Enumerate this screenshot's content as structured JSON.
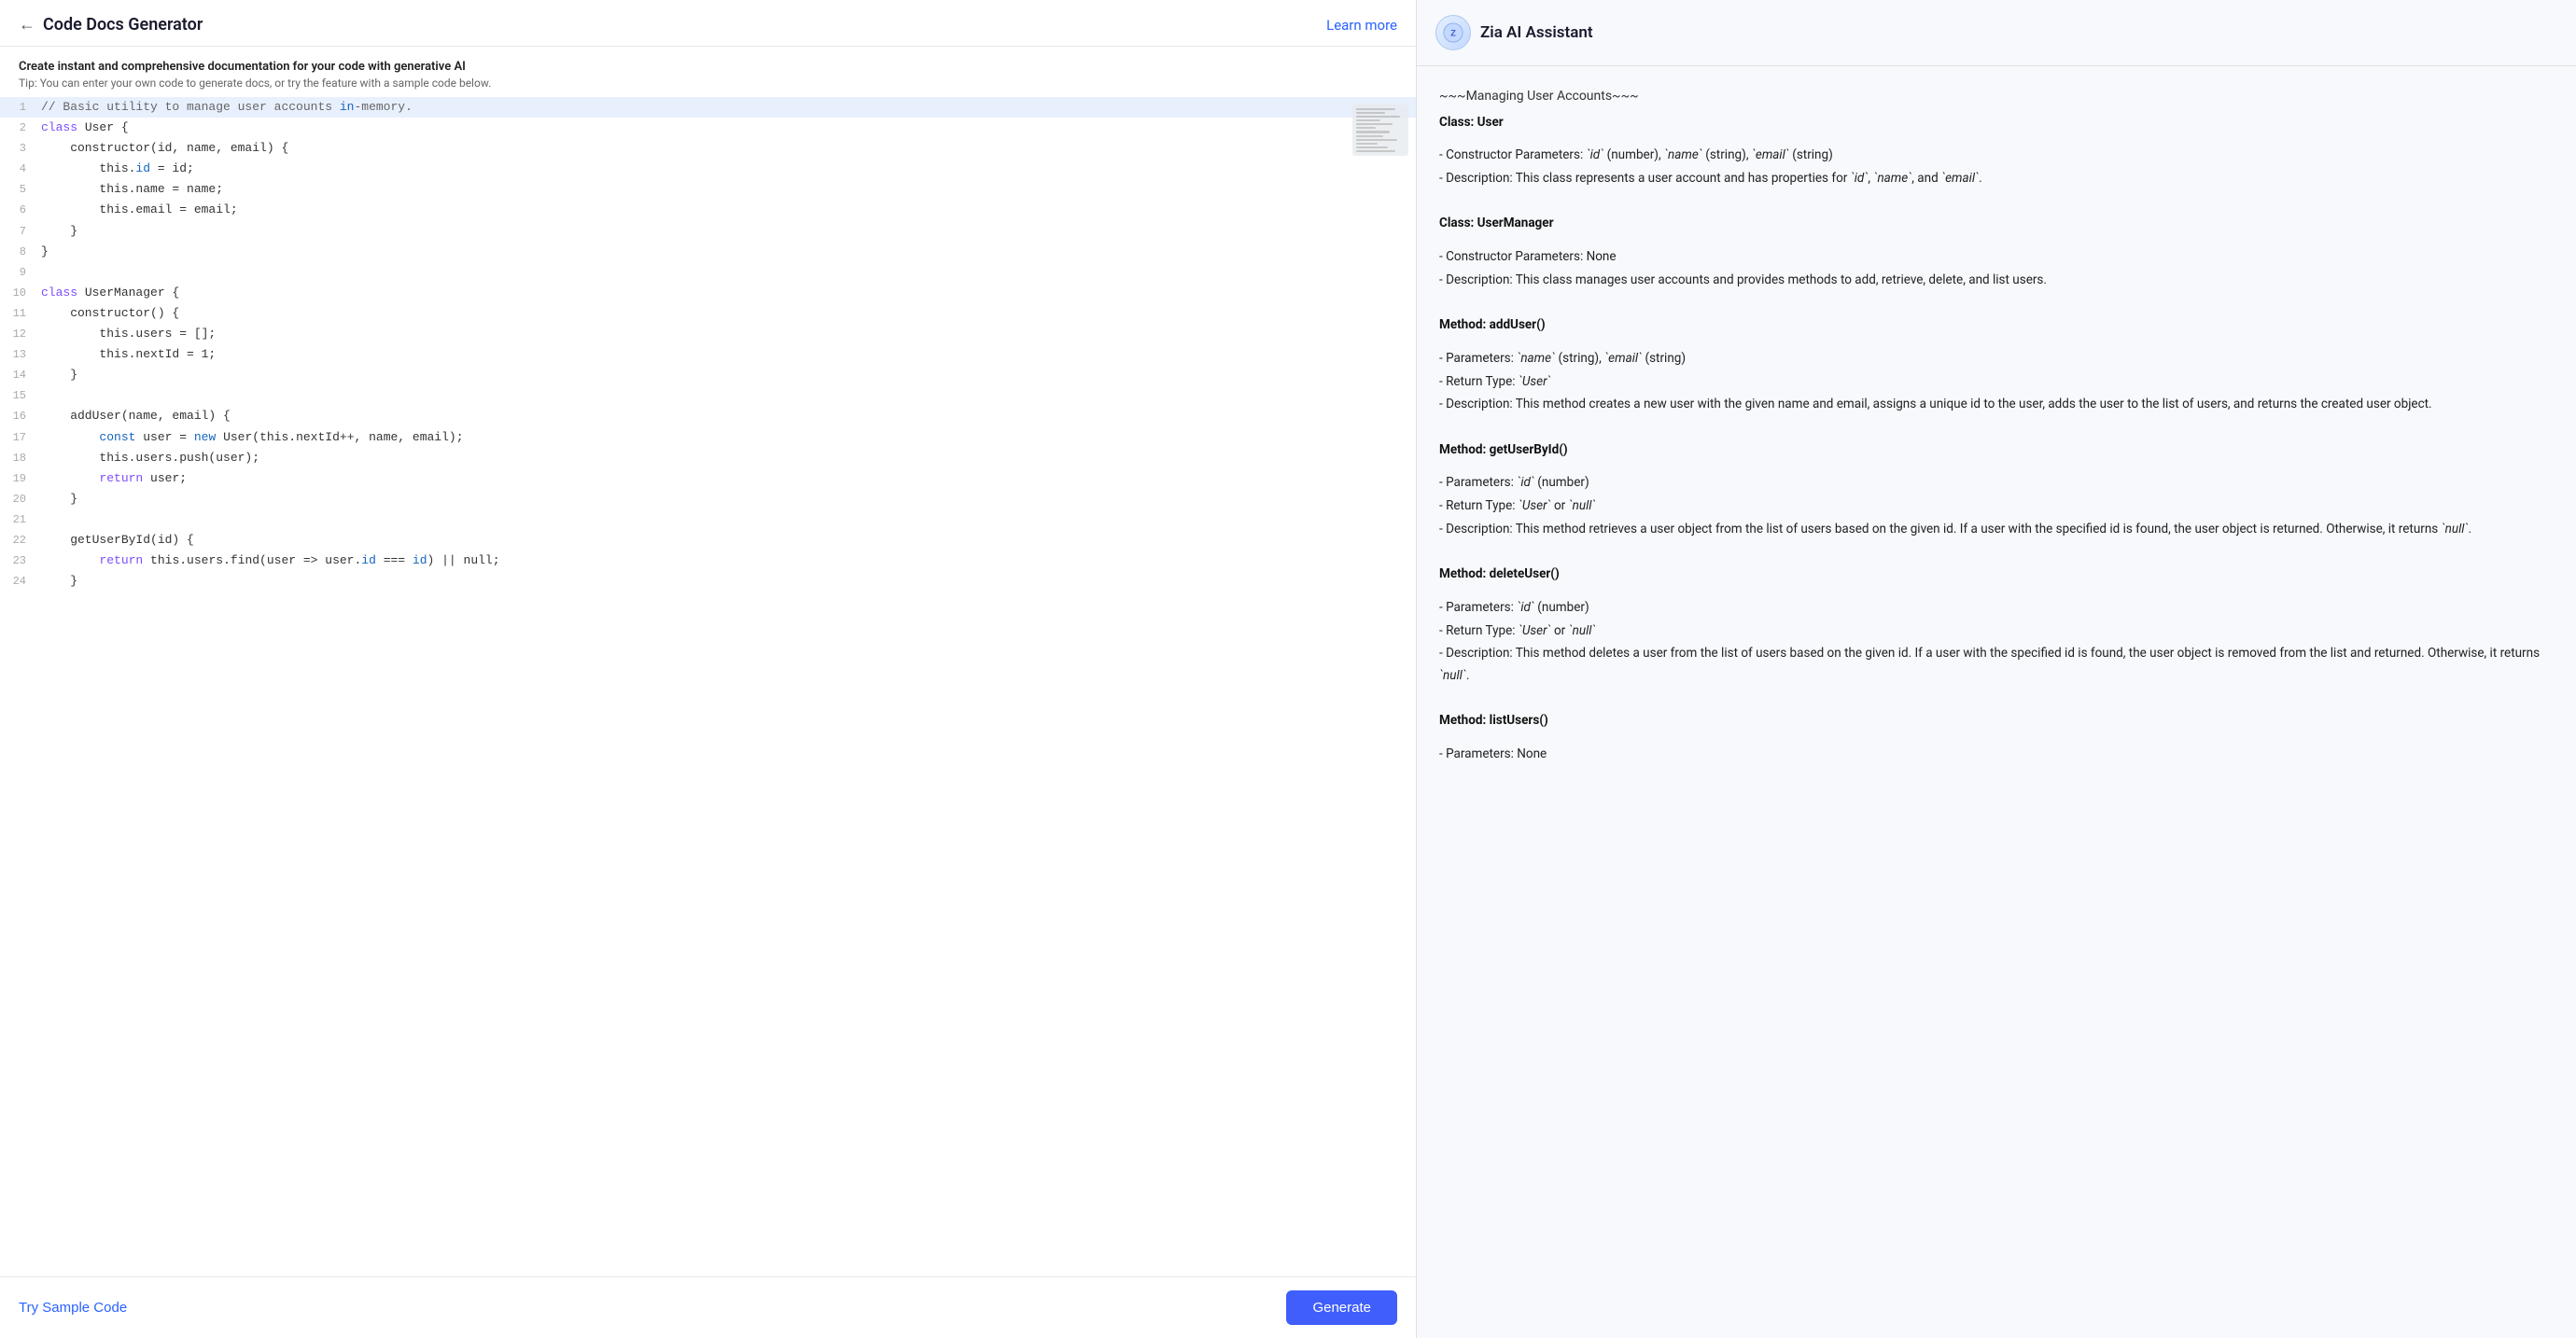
{
  "header": {
    "back_label": "←",
    "title": "Code Docs Generator",
    "learn_more": "Learn more"
  },
  "subtitle": {
    "main": "Create instant and comprehensive documentation for your code with generative AI",
    "tip": "Tip: You can enter your own code to generate docs, or try the feature with a sample code below."
  },
  "code": {
    "lines": [
      {
        "num": 1,
        "content": "// Basic utility to manage user accounts in-memory.",
        "highlight": true
      },
      {
        "num": 2,
        "content": "class User {"
      },
      {
        "num": 3,
        "content": "    constructor(id, name, email) {"
      },
      {
        "num": 4,
        "content": "        this.id = id;"
      },
      {
        "num": 5,
        "content": "        this.name = name;"
      },
      {
        "num": 6,
        "content": "        this.email = email;"
      },
      {
        "num": 7,
        "content": "    }"
      },
      {
        "num": 8,
        "content": "}"
      },
      {
        "num": 9,
        "content": ""
      },
      {
        "num": 10,
        "content": "class UserManager {"
      },
      {
        "num": 11,
        "content": "    constructor() {"
      },
      {
        "num": 12,
        "content": "        this.users = [];"
      },
      {
        "num": 13,
        "content": "        this.nextId = 1;"
      },
      {
        "num": 14,
        "content": "    }"
      },
      {
        "num": 15,
        "content": ""
      },
      {
        "num": 16,
        "content": "    addUser(name, email) {"
      },
      {
        "num": 17,
        "content": "        const user = new User(this.nextId++, name, email);"
      },
      {
        "num": 18,
        "content": "        this.users.push(user);"
      },
      {
        "num": 19,
        "content": "        return user;"
      },
      {
        "num": 20,
        "content": "    }"
      },
      {
        "num": 21,
        "content": ""
      },
      {
        "num": 22,
        "content": "    getUserById(id) {"
      },
      {
        "num": 23,
        "content": "        return this.users.find(user => user.id === id) || null;"
      },
      {
        "num": 24,
        "content": "    }"
      }
    ]
  },
  "bottom_bar": {
    "try_sample": "Try Sample Code",
    "generate": "Generate"
  },
  "ai_panel": {
    "title": "Zia AI Assistant",
    "content": {
      "managing_header": "~~~Managing User Accounts~~~",
      "class_user_title": "Class: User",
      "class_user_items": [
        "- Constructor Parameters: `id` (number), `name` (string), `email` (string)",
        "- Description: This class represents a user account and has properties for `id`, `name`, and `email`."
      ],
      "class_usermanager_title": "Class: UserManager",
      "class_usermanager_items": [
        "- Constructor Parameters: None",
        "- Description: This class manages user accounts and provides methods to add, retrieve, delete, and list users."
      ],
      "method_adduser_title": "Method: addUser()",
      "method_adduser_items": [
        "- Parameters: `name` (string), `email` (string)",
        "- Return Type: `User`",
        "- Description: This method creates a new user with the given name and email, assigns a unique id to the user, adds the user to the list of users, and returns the created user object."
      ],
      "method_getuserbyid_title": "Method: getUserById()",
      "method_getuserbyid_items": [
        "- Parameters: `id` (number)",
        "- Return Type: `User` or `null`",
        "- Description: This method retrieves a user object from the list of users based on the given id. If a user with the specified id is found, the user object is returned. Otherwise, it returns `null`."
      ],
      "method_deleteuser_title": "Method: deleteUser()",
      "method_deleteuser_items": [
        "- Parameters: `id` (number)",
        "- Return Type: `User` or `null`",
        "- Description: This method deletes a user from the list of users based on the given id. If a user with the specified id is found, the user object is removed from the list and returned. Otherwise, it returns `null`."
      ],
      "method_listusers_title": "Method: listUsers()",
      "method_listusers_items": [
        "- Parameters: None"
      ]
    }
  }
}
